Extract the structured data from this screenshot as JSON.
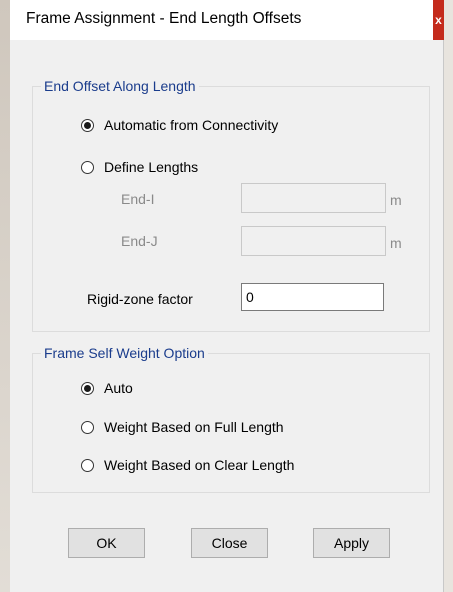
{
  "window": {
    "title": "Frame Assignment - End Length Offsets",
    "close_label": "x"
  },
  "end_offset_group": {
    "label": "End Offset Along Length",
    "options": [
      {
        "label": "Automatic from Connectivity",
        "selected": true
      },
      {
        "label": "Define Lengths",
        "selected": false
      }
    ],
    "end_i": {
      "label": "End-I",
      "value": "",
      "unit": "m",
      "enabled": false
    },
    "end_j": {
      "label": "End-J",
      "value": "",
      "unit": "m",
      "enabled": false
    },
    "rigid_zone": {
      "label": "Rigid-zone factor",
      "value": "0",
      "enabled": true
    }
  },
  "self_weight_group": {
    "label": "Frame Self Weight Option",
    "options": [
      {
        "label": "Auto",
        "selected": true
      },
      {
        "label": "Weight Based on Full Length",
        "selected": false
      },
      {
        "label": "Weight Based on Clear Length",
        "selected": false
      }
    ]
  },
  "buttons": {
    "ok": "OK",
    "close": "Close",
    "apply": "Apply"
  }
}
